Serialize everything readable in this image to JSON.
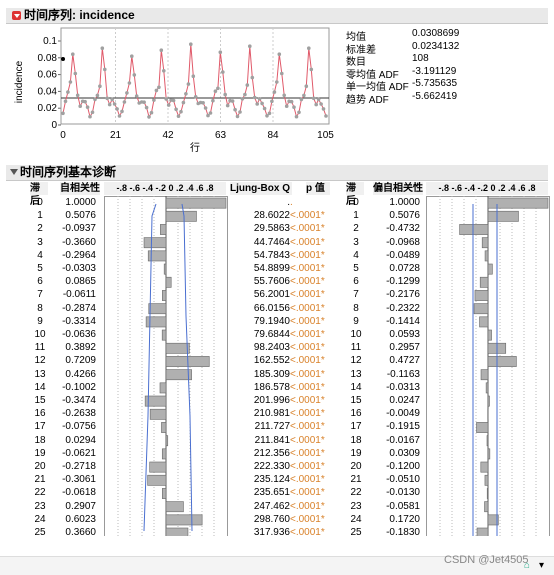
{
  "section1": {
    "title": "时间序列: incidence"
  },
  "stats": [
    {
      "label": "均值",
      "value": "0.0308699"
    },
    {
      "label": "标准差",
      "value": "0.0234132"
    },
    {
      "label": "数目",
      "value": "108"
    },
    {
      "label": "零均值 ADF",
      "value": "-3.191129"
    },
    {
      "label": "单一均值 ADF",
      "value": "-5.735635"
    },
    {
      "label": "趋势 ADF",
      "value": "-5.662419"
    }
  ],
  "plot": {
    "ylabel": "incidence",
    "xlabel": "行",
    "yticks": [
      "0.1",
      "0.08",
      "0.06",
      "0.04",
      "0.02",
      "0"
    ],
    "xticks": [
      "0",
      "21",
      "42",
      "63",
      "84",
      "105"
    ]
  },
  "section2": {
    "title": "时间序列基本诊断"
  },
  "table": {
    "headers": {
      "lag": "滞后",
      "acf": "自相关性",
      "acf_scale": "-.8 -.6 -.4 -.2  0  .2  .4  .6  .8",
      "q": "Ljung-Box Q",
      "p": "p 值",
      "lag2": "滞后",
      "pacf": "偏自相关性",
      "pacf_scale": "-.8 -.6 -.4 -.2  0  .2  .4  .6  .8"
    },
    "rows": [
      {
        "lag": "0",
        "acf": "1.0000",
        "q": ".",
        "p": ".",
        "pacf": "1.0000"
      },
      {
        "lag": "1",
        "acf": "0.5076",
        "q": "28.6022",
        "p": "<.0001*",
        "pacf": "0.5076"
      },
      {
        "lag": "2",
        "acf": "-0.0937",
        "q": "29.5863",
        "p": "<.0001*",
        "pacf": "-0.4732"
      },
      {
        "lag": "3",
        "acf": "-0.3660",
        "q": "44.7464",
        "p": "<.0001*",
        "pacf": "-0.0968"
      },
      {
        "lag": "4",
        "acf": "-0.2964",
        "q": "54.7843",
        "p": "<.0001*",
        "pacf": "-0.0489"
      },
      {
        "lag": "5",
        "acf": "-0.0303",
        "q": "54.8899",
        "p": "<.0001*",
        "pacf": "0.0728"
      },
      {
        "lag": "6",
        "acf": "0.0865",
        "q": "55.7606",
        "p": "<.0001*",
        "pacf": "-0.1299"
      },
      {
        "lag": "7",
        "acf": "-0.0611",
        "q": "56.2001",
        "p": "<.0001*",
        "pacf": "-0.2176"
      },
      {
        "lag": "8",
        "acf": "-0.2874",
        "q": "66.0156",
        "p": "<.0001*",
        "pacf": "-0.2322"
      },
      {
        "lag": "9",
        "acf": "-0.3314",
        "q": "79.1940",
        "p": "<.0001*",
        "pacf": "-0.1414"
      },
      {
        "lag": "10",
        "acf": "-0.0636",
        "q": "79.6844",
        "p": "<.0001*",
        "pacf": "0.0593"
      },
      {
        "lag": "11",
        "acf": "0.3892",
        "q": "98.2403",
        "p": "<.0001*",
        "pacf": "0.2957"
      },
      {
        "lag": "12",
        "acf": "0.7209",
        "q": "162.552",
        "p": "<.0001*",
        "pacf": "0.4727"
      },
      {
        "lag": "13",
        "acf": "0.4266",
        "q": "185.309",
        "p": "<.0001*",
        "pacf": "-0.1163"
      },
      {
        "lag": "14",
        "acf": "-0.1002",
        "q": "186.578",
        "p": "<.0001*",
        "pacf": "-0.0313"
      },
      {
        "lag": "15",
        "acf": "-0.3474",
        "q": "201.996",
        "p": "<.0001*",
        "pacf": "0.0247"
      },
      {
        "lag": "16",
        "acf": "-0.2638",
        "q": "210.981",
        "p": "<.0001*",
        "pacf": "-0.0049"
      },
      {
        "lag": "17",
        "acf": "-0.0756",
        "q": "211.727",
        "p": "<.0001*",
        "pacf": "-0.1915"
      },
      {
        "lag": "18",
        "acf": "0.0294",
        "q": "211.841",
        "p": "<.0001*",
        "pacf": "-0.0167"
      },
      {
        "lag": "19",
        "acf": "-0.0621",
        "q": "212.356",
        "p": "<.0001*",
        "pacf": "0.0309"
      },
      {
        "lag": "20",
        "acf": "-0.2718",
        "q": "222.330",
        "p": "<.0001*",
        "pacf": "-0.1200"
      },
      {
        "lag": "21",
        "acf": "-0.3061",
        "q": "235.124",
        "p": "<.0001*",
        "pacf": "-0.0510"
      },
      {
        "lag": "22",
        "acf": "-0.0618",
        "q": "235.651",
        "p": "<.0001*",
        "pacf": "-0.0130"
      },
      {
        "lag": "23",
        "acf": "0.2907",
        "q": "247.462",
        "p": "<.0001*",
        "pacf": "-0.0581"
      },
      {
        "lag": "24",
        "acf": "0.6023",
        "q": "298.760",
        "p": "<.0001*",
        "pacf": "0.1720"
      },
      {
        "lag": "25",
        "acf": "0.3660",
        "q": "317.936",
        "p": "<.0001*",
        "pacf": "-0.1830"
      }
    ]
  },
  "watermark": "CSDN @Jet4505",
  "colors": {
    "bar": "#b0b0b0",
    "ci_line": "#4a6fd0",
    "series_line": "#e05a6a",
    "point": "#a0a0a0"
  }
}
